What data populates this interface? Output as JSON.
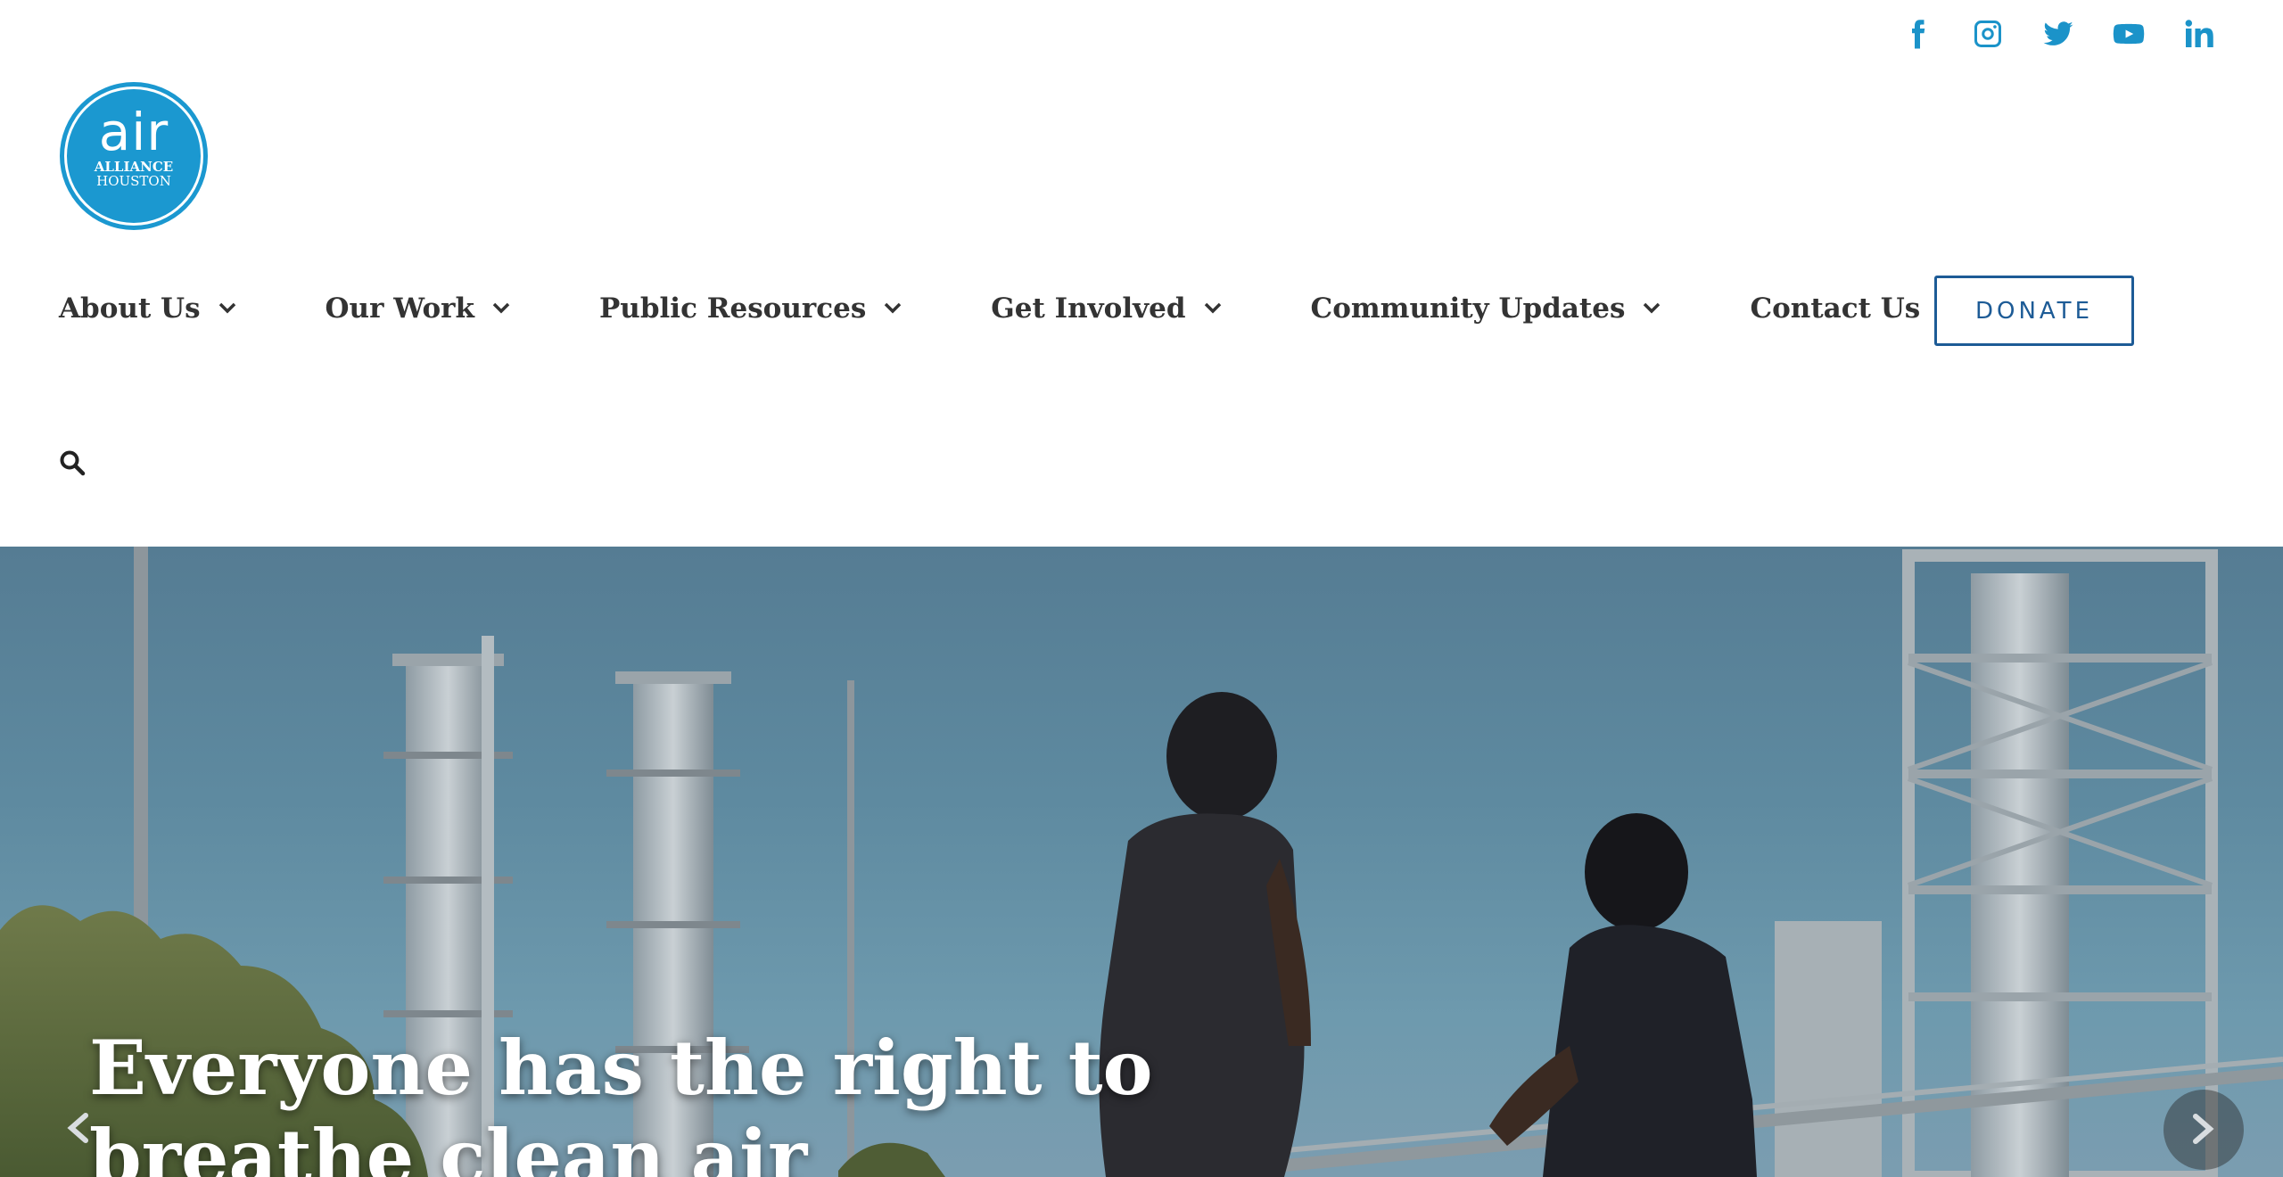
{
  "brand": {
    "logo_main": "air",
    "logo_line2": "ALLIANCE",
    "logo_line3": "HOUSTON",
    "color": "#1b98d0"
  },
  "social": [
    {
      "name": "facebook",
      "icon": "facebook-icon"
    },
    {
      "name": "instagram",
      "icon": "instagram-icon"
    },
    {
      "name": "twitter",
      "icon": "twitter-icon"
    },
    {
      "name": "youtube",
      "icon": "youtube-icon"
    },
    {
      "name": "linkedin",
      "icon": "linkedin-icon"
    }
  ],
  "nav": {
    "items": [
      {
        "label": "About Us",
        "has_dropdown": true
      },
      {
        "label": "Our Work",
        "has_dropdown": true
      },
      {
        "label": "Public Resources",
        "has_dropdown": true
      },
      {
        "label": "Get Involved",
        "has_dropdown": true
      },
      {
        "label": "Community Updates",
        "has_dropdown": true
      },
      {
        "label": "Contact Us",
        "has_dropdown": false
      }
    ],
    "donate_label": "DONATE",
    "search_icon": "search-icon"
  },
  "hero": {
    "title": "Everyone has the right to breathe clean air",
    "prev_icon": "chevron-left-icon",
    "next_icon": "chevron-right-icon"
  },
  "colors": {
    "accent": "#1b93c9",
    "donate_border": "#1d5b96",
    "nav_text": "#333333"
  }
}
